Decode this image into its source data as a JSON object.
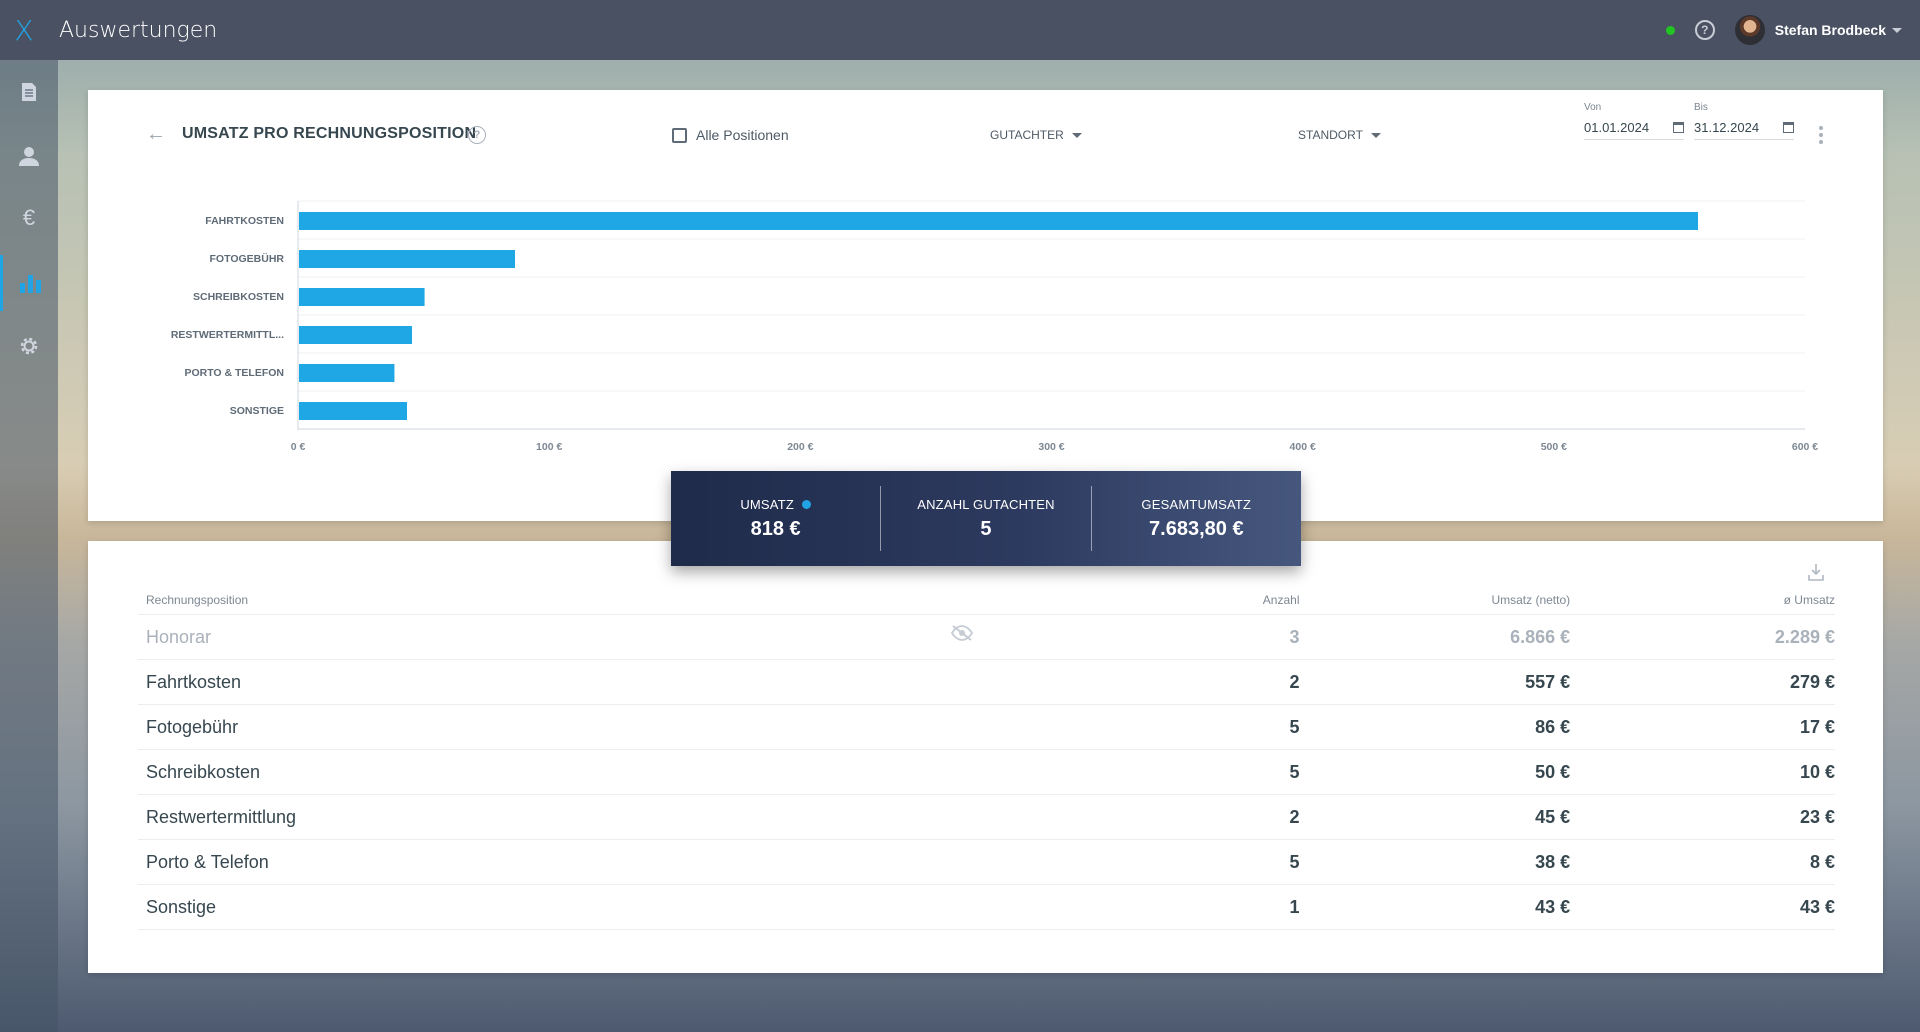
{
  "header": {
    "app_title": "Auswertungen",
    "logo_text": "X",
    "user_name": "Stefan Brodbeck",
    "help_glyph": "?",
    "status_color": "#21c521"
  },
  "sidebar": {
    "items": [
      {
        "icon": "document-icon"
      },
      {
        "icon": "person-icon"
      },
      {
        "icon": "euro-icon",
        "glyph": "€"
      },
      {
        "icon": "bar-chart-icon",
        "active": true
      },
      {
        "icon": "gear-icon"
      }
    ]
  },
  "toolbar": {
    "back_glyph": "←",
    "title": "UMSATZ PRO RECHNUNGSPOSITION",
    "title_help": "?",
    "all_positions_label": "Alle Positionen",
    "gutachter_label": "GUTACHTER",
    "standort_label": "STANDORT",
    "von_label": "Von",
    "von_value": "01.01.2024",
    "bis_label": "Bis",
    "bis_value": "31.12.2024"
  },
  "chart_data": {
    "type": "bar",
    "orientation": "horizontal",
    "categories": [
      "FAHRTKOSTEN",
      "FOTOGEBÜHR",
      "SCHREIBKOSTEN",
      "RESTWERTERMITTL...",
      "PORTO & TELEFON",
      "SONSTIGE"
    ],
    "values": [
      557,
      86,
      50,
      45,
      38,
      43
    ],
    "xlim": [
      0,
      600
    ],
    "x_ticks": [
      "0 €",
      "100 €",
      "200 €",
      "300 €",
      "400 €",
      "500 €",
      "600 €"
    ],
    "bar_color": "#1ea7e4",
    "grid": true
  },
  "summary": {
    "umsatz_label": "UMSATZ",
    "umsatz_value": "818 €",
    "anzahl_label": "ANZAHL GUTACHTEN",
    "anzahl_value": "5",
    "gesamt_label": "GESAMTUMSATZ",
    "gesamt_value": "7.683,80 €"
  },
  "table": {
    "headers": {
      "name": "Rechnungsposition",
      "count": "Anzahl",
      "revenue": "Umsatz (netto)",
      "avg": "ø Umsatz"
    },
    "rows": [
      {
        "name": "Honorar",
        "count": "3",
        "revenue": "6.866 €",
        "avg": "2.289 €",
        "muted": true
      },
      {
        "name": "Fahrtkosten",
        "count": "2",
        "revenue": "557 €",
        "avg": "279 €"
      },
      {
        "name": "Fotogebühr",
        "count": "5",
        "revenue": "86 €",
        "avg": "17 €"
      },
      {
        "name": "Schreibkosten",
        "count": "5",
        "revenue": "50 €",
        "avg": "10 €"
      },
      {
        "name": "Restwertermittlung",
        "count": "2",
        "revenue": "45 €",
        "avg": "23 €"
      },
      {
        "name": "Porto & Telefon",
        "count": "5",
        "revenue": "38 €",
        "avg": "8 €"
      },
      {
        "name": "Sonstige",
        "count": "1",
        "revenue": "43 €",
        "avg": "43 €"
      }
    ]
  }
}
